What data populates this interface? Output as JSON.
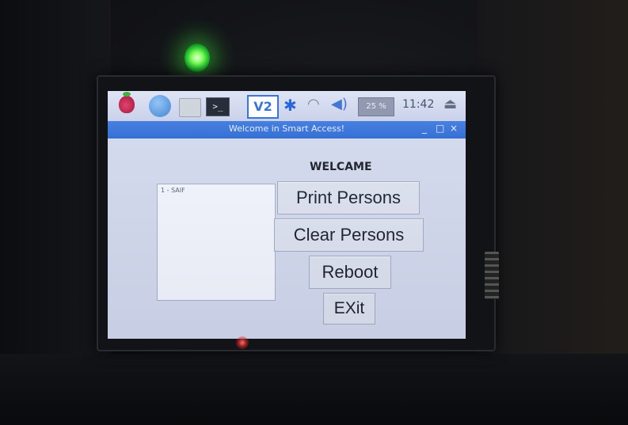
{
  "taskbar": {
    "icons": [
      "raspberry-pi-menu-icon",
      "globe-browser-icon",
      "folder-icon",
      "terminal-icon",
      "vnc-icon",
      "bluetooth-icon",
      "wifi-icon",
      "volume-icon",
      "cpu-monitor-icon",
      "eject-icon"
    ],
    "terminal_glyph": ">_",
    "vnc_label": "V2",
    "cpu_label": "25 %",
    "clock": "11:42"
  },
  "window": {
    "title": "Welcome in Smart Access!",
    "controls": {
      "minimize": "_",
      "maximize": "□",
      "close": "×"
    }
  },
  "main": {
    "heading": "WELCAME",
    "list_items": [
      "1 - SAIF"
    ],
    "buttons": {
      "print": "Print Persons",
      "clear": "Clear Persons",
      "reboot": "Reboot",
      "exit": "EXit"
    }
  },
  "colors": {
    "titlebar": "#2f6bd4",
    "window_bg": "#d4dbef",
    "led": "#3ce03c"
  }
}
